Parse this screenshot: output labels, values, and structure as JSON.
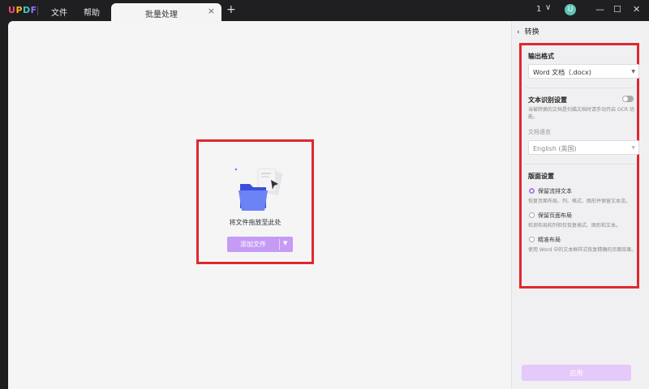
{
  "app": {
    "logo_letters": [
      {
        "ch": "U",
        "color": "#ff4d6d"
      },
      {
        "ch": "P",
        "color": "#ffb020"
      },
      {
        "ch": "D",
        "color": "#3ec7b4"
      },
      {
        "ch": "F",
        "color": "#9b6cff"
      }
    ]
  },
  "menu": {
    "file": "文件",
    "help": "帮助"
  },
  "tab": {
    "label": "批量处理",
    "close": "×",
    "add": "+"
  },
  "window": {
    "count": "1",
    "chevron": "∨",
    "avatar_initial": "U",
    "minimize": "—",
    "maximize": "☐",
    "close": "✕"
  },
  "dropzone": {
    "text": "将文件拖放至此处",
    "add_button": "添加文件",
    "add_caret": "▼"
  },
  "panel": {
    "back": "‹",
    "title": "转换",
    "output_format": {
      "title": "输出格式",
      "value": "Word 文档（.docx)"
    },
    "ocr": {
      "title": "文本识别设置",
      "enabled": false,
      "description": "当被转换的文档是扫描文档时请手动开启 OCR 功能。",
      "language_label": "文档语言",
      "language_value": "English (英国)"
    },
    "layout": {
      "title": "版面设置",
      "options": [
        {
          "label": "保留流排文本",
          "desc": "恢复页面布局、列、格式、图形并保留文本流。",
          "selected": true
        },
        {
          "label": "保留页面布局",
          "desc": "检测布局和列但仅恢复格式、图形和文本。",
          "selected": false
        },
        {
          "label": "精准布局",
          "desc": "使用 Word 中的文本框样式恢复精确的页面效果。",
          "selected": false
        }
      ]
    },
    "apply_button": "应用"
  },
  "colors": {
    "accent": "#c59bf6",
    "highlight_border": "#e0282e",
    "titlebar": "#1f1f22"
  }
}
